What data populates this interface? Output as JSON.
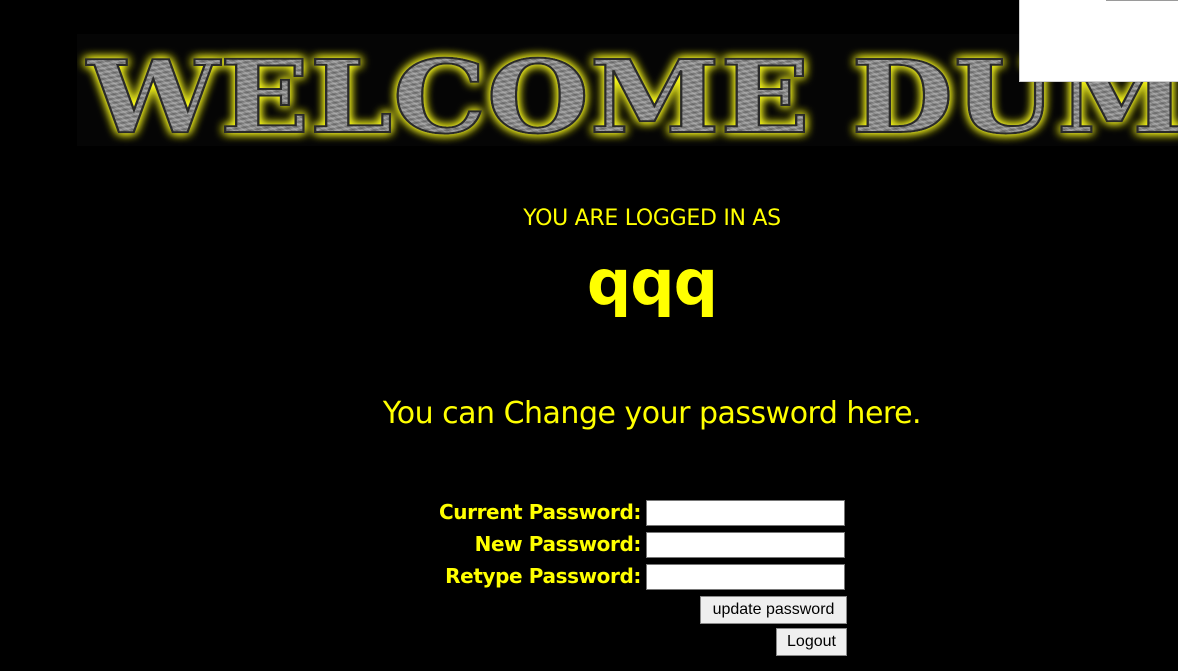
{
  "banner": {
    "text": "WELCOME DUMB"
  },
  "header": {
    "logged_in_label": "YOU ARE LOGGED IN AS",
    "username": "qqq"
  },
  "main": {
    "change_message": "You can Change your password here."
  },
  "form": {
    "current_password_label": "Current Password:",
    "current_password_value": "",
    "new_password_label": "New Password:",
    "new_password_value": "",
    "retype_password_label": "Retype Password:",
    "retype_password_value": "",
    "update_button_label": "update password",
    "logout_button_label": "Logout"
  },
  "colors": {
    "background": "#000000",
    "text": "#ffff00",
    "banner_glow": "#ffff33",
    "banner_metal": "#8c8c8c"
  }
}
